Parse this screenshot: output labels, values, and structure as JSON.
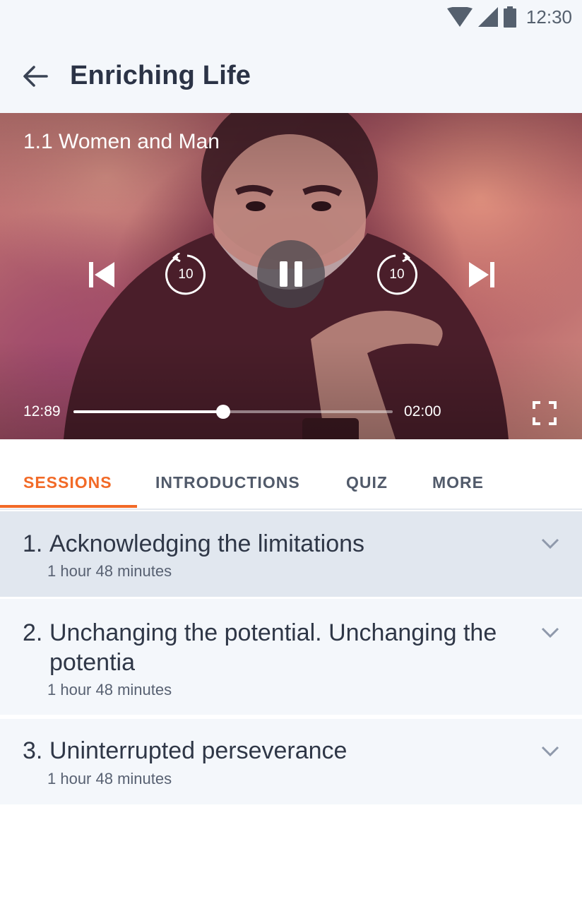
{
  "status_bar": {
    "time": "12:30",
    "icons": [
      "wifi-icon",
      "cell-signal-icon",
      "battery-icon"
    ]
  },
  "header": {
    "title": "Enriching Life",
    "back_icon": "arrow-left-icon"
  },
  "player": {
    "session_title": "1.1 Women and Man",
    "elapsed": "12:89",
    "duration": "02:00",
    "progress_fraction": 0.47,
    "rewind_seconds": "10",
    "forward_seconds": "10",
    "state": "playing",
    "controls": [
      "skip-previous-icon",
      "rewind-10-icon",
      "pause-icon",
      "forward-10-icon",
      "skip-next-icon",
      "fullscreen-icon"
    ]
  },
  "tabs": [
    {
      "label": "SESSIONS",
      "active": true
    },
    {
      "label": "INTRODUCTIONS",
      "active": false
    },
    {
      "label": "QUIZ",
      "active": false
    },
    {
      "label": "MORE",
      "active": false
    }
  ],
  "sessions": [
    {
      "number": "1.",
      "title": "Acknowledging the limitations",
      "duration": "1 hour 48 minutes",
      "highlighted": true
    },
    {
      "number": "2.",
      "title": "Unchanging the potential. Unchanging the potentia",
      "duration": "1 hour 48 minutes",
      "highlighted": false
    },
    {
      "number": "3.",
      "title": "Uninterrupted perseverance",
      "duration": "1 hour 48 minutes",
      "highlighted": false
    }
  ],
  "colors": {
    "accent": "#f26a27",
    "header_bg": "#f4f7fb",
    "highlight_row": "#e1e7ef",
    "row_bg": "#f4f7fb",
    "text_dark": "#2f3747"
  }
}
